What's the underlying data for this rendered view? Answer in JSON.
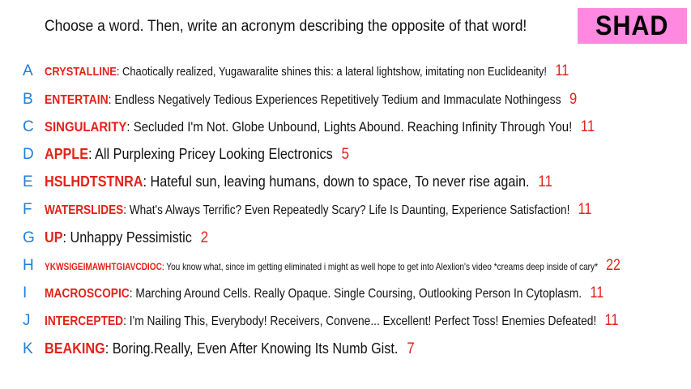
{
  "prompt": "Choose a word. Then, write an acronym describing the opposite of that word!",
  "badge": {
    "label": "SHAD",
    "color": "#ff88e0"
  },
  "colors": {
    "letter": "#1f7fd8",
    "word": "#e2221a",
    "score": "#e2221a",
    "text": "#111111"
  },
  "entries": [
    {
      "letter": "A",
      "word": "CRYSTALLINE",
      "acronym": "Chaotically realized, Yugawaralite shines this: a lateral lightshow, imitating non Euclideanity!",
      "score": "11"
    },
    {
      "letter": "B",
      "word": "ENTERTAIN",
      "acronym": "Endless Negatively Tedious Experiences Repetitively Tedium and Immaculate Nothingess",
      "score": "9"
    },
    {
      "letter": "C",
      "word": "SINGULARITY",
      "acronym": "Secluded I'm Not. Globe Unbound, Lights Abound. Reaching Infinity Through You!",
      "score": "11"
    },
    {
      "letter": "D",
      "word": "APPLE",
      "acronym": "All Purplexing Pricey Looking Electronics",
      "score": "5"
    },
    {
      "letter": "E",
      "word": "HSLHDTSTNRA",
      "acronym": "Hateful sun, leaving humans, down to space, To never rise again.",
      "score": "11"
    },
    {
      "letter": "F",
      "word": "WATERSLIDES",
      "acronym": "What's Always Terrific? Even Repeatedly Scary? Life Is Daunting, Experience Satisfaction!",
      "score": "11"
    },
    {
      "letter": "G",
      "word": "UP",
      "acronym": "Unhappy Pessimistic",
      "score": "2"
    },
    {
      "letter": "H",
      "word": "YKWSIGEIMAWHTGIAVCDIOC",
      "acronym": "You know what, since im getting eliminated i might as well hope to get into Alexlion's video *creams deep inside of cary*",
      "score": "22"
    },
    {
      "letter": "I",
      "word": "MACROSCOPIC",
      "acronym": "Marching Around Cells. Really Opaque. Single Coursing, Outlooking Person In Cytoplasm.",
      "score": "11"
    },
    {
      "letter": "J",
      "word": "INTERCEPTED",
      "acronym": "I'm Nailing This, Everybody! Receivers, Convene... Excellent! Perfect Toss! Enemies Defeated!",
      "score": "11"
    },
    {
      "letter": "K",
      "word": "BEAKING",
      "acronym": "Boring.Really, Even After Knowing Its Numb Gist.",
      "score": "7"
    }
  ]
}
